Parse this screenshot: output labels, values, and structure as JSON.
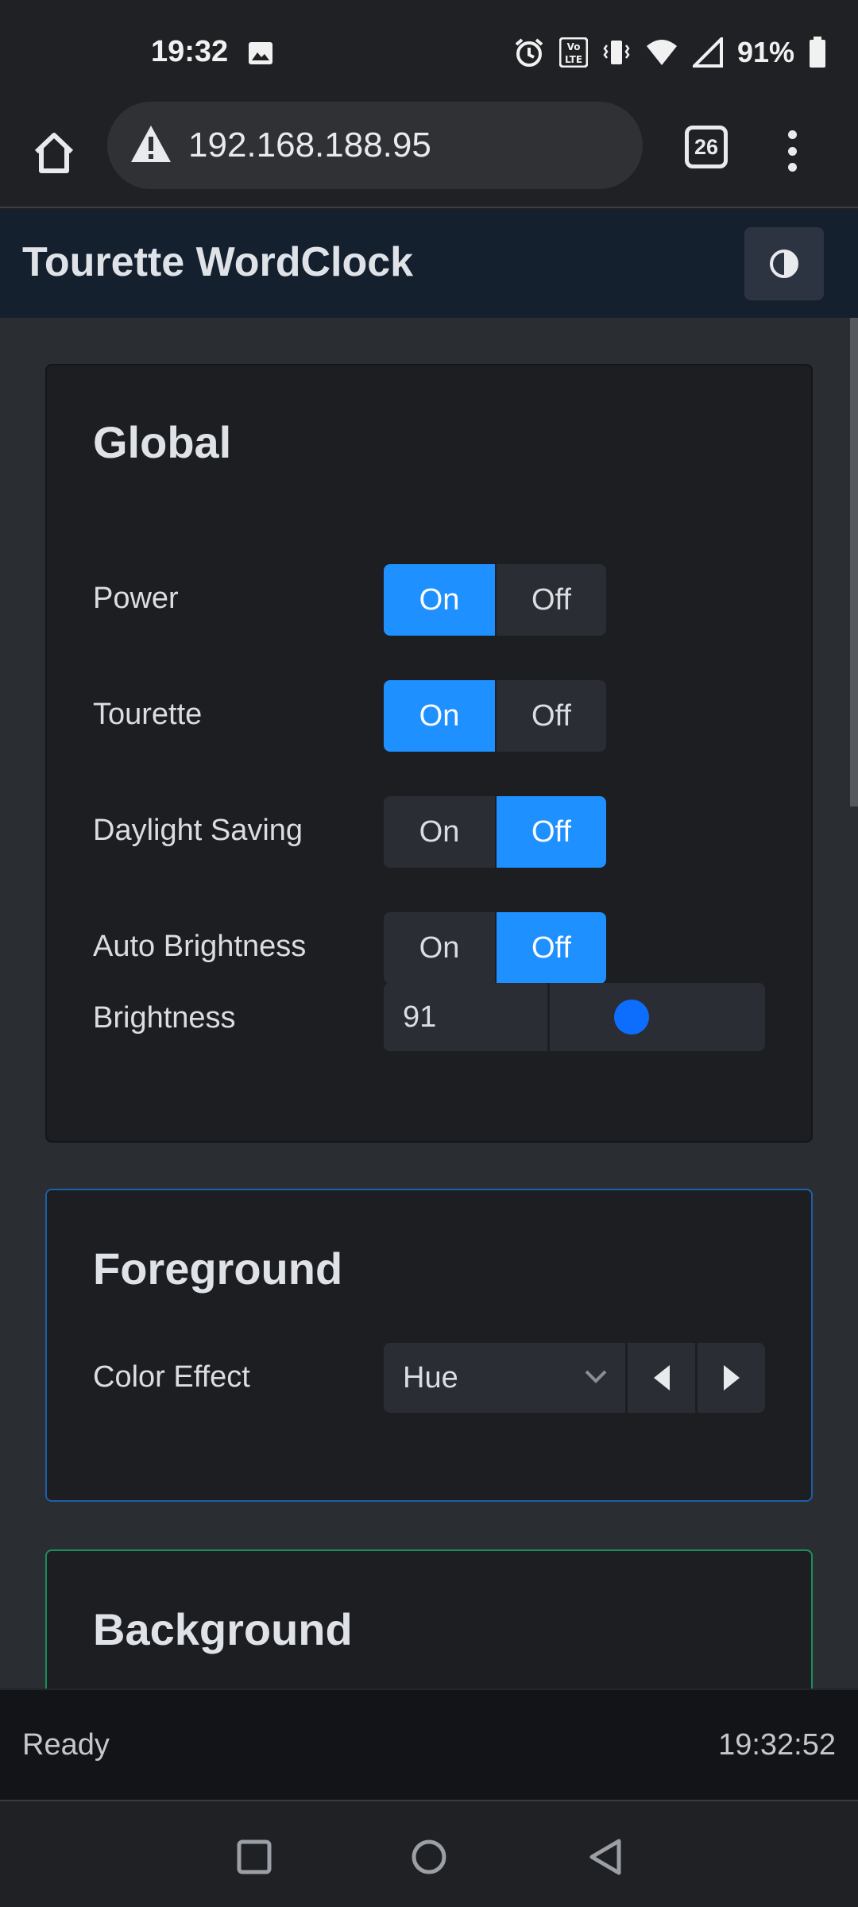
{
  "status_bar": {
    "time": "19:32",
    "battery_percent": "91%",
    "icons": [
      "image-icon",
      "alarm-icon",
      "volte-icon",
      "vibrate-icon",
      "wifi-icon",
      "signal-icon",
      "battery-icon"
    ]
  },
  "browser": {
    "url": "192.168.188.95",
    "tab_count": "26",
    "icons": [
      "home-icon",
      "warning-icon",
      "tabs-icon",
      "menu-icon"
    ]
  },
  "app": {
    "title": "Tourette WordClock",
    "theme_icon": "contrast-icon"
  },
  "global": {
    "title": "Global",
    "power": {
      "label": "Power",
      "on": "On",
      "off": "Off",
      "selected": "On"
    },
    "tourette": {
      "label": "Tourette",
      "on": "On",
      "off": "Off",
      "selected": "On"
    },
    "daylight_saving": {
      "label": "Daylight Saving",
      "on": "On",
      "off": "Off",
      "selected": "Off"
    },
    "auto_brightness": {
      "label": "Auto Brightness",
      "on": "On",
      "off": "Off",
      "selected": "Off"
    },
    "brightness": {
      "label": "Brightness",
      "value": "91"
    }
  },
  "foreground": {
    "title": "Foreground",
    "color_effect": {
      "label": "Color Effect",
      "value": "Hue"
    }
  },
  "background": {
    "title": "Background"
  },
  "footer": {
    "status": "Ready",
    "time": "19:32:52"
  },
  "colors": {
    "accent": "#1e90ff",
    "header_bg": "#15202f",
    "foreground_border": "#1d5fa8",
    "background_border": "#1c8e5a"
  }
}
